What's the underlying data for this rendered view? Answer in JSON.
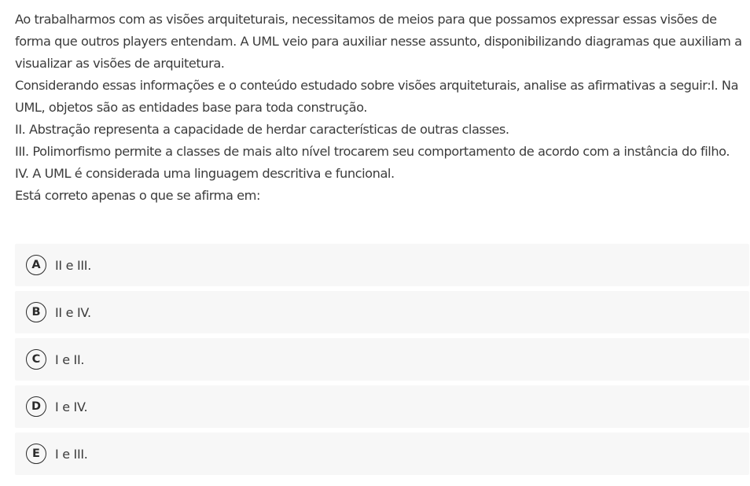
{
  "question": {
    "lines": [
      "Ao trabalharmos com as visões arquiteturais, necessitamos de meios para que possamos expressar essas visões de forma que outros players entendam. A UML veio para auxiliar nesse assunto, disponibilizando diagramas que auxiliam a visualizar as visões de arquitetura.",
      "Considerando essas informações e o conteúdo estudado sobre visões arquiteturais, analise as afirmativas a seguir:I. Na UML, objetos são as entidades base para toda construção.",
      "II. Abstração representa a capacidade de herdar características de outras classes.",
      "III. Polimorfismo permite a classes de mais alto nível trocarem seu comportamento de acordo com a instância do filho.",
      "IV. A UML é considerada uma linguagem descritiva e funcional.",
      "Está correto apenas o que se afirma em:"
    ]
  },
  "options": [
    {
      "letter": "A",
      "text": "II e III."
    },
    {
      "letter": "B",
      "text": "II e IV."
    },
    {
      "letter": "C",
      "text": "I e II."
    },
    {
      "letter": "D",
      "text": "I e IV."
    },
    {
      "letter": "E",
      "text": "I e III."
    }
  ]
}
